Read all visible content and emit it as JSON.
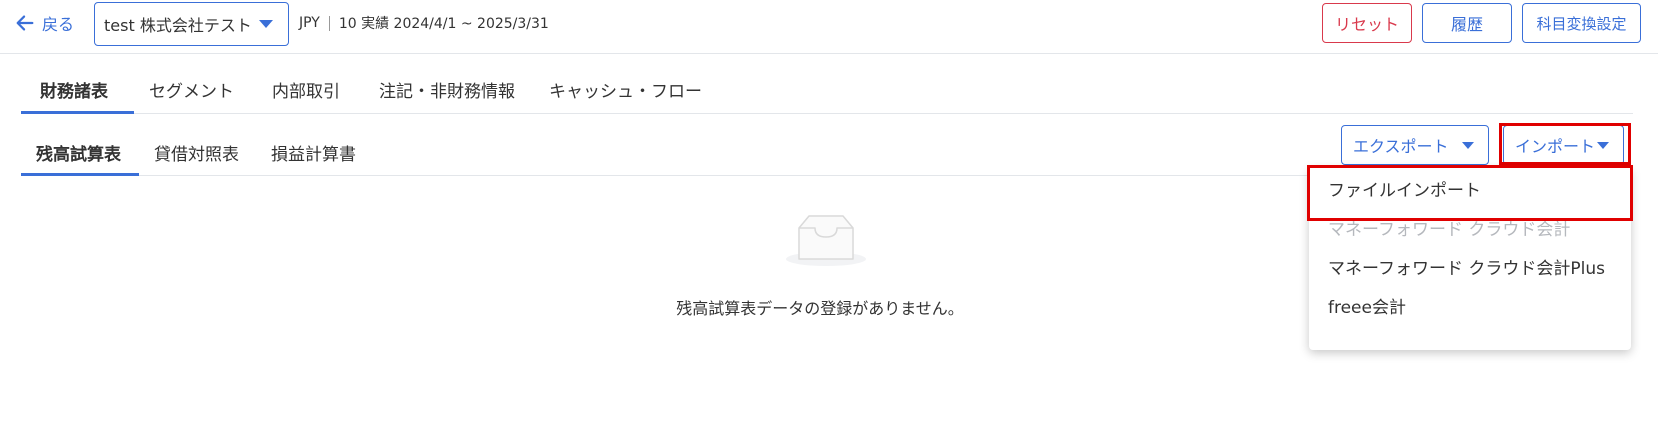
{
  "header": {
    "back_label": "戻る",
    "company_name": "test 株式会社テスト",
    "currency": "JPY",
    "period": "10 実績 2024/4/1 ~ 2025/3/31",
    "reset_label": "リセット",
    "history_label": "履歴",
    "account_conversion_label": "科目変換設定"
  },
  "primary_tabs": [
    {
      "label": "財務諸表",
      "active": true
    },
    {
      "label": "セグメント",
      "active": false
    },
    {
      "label": "内部取引",
      "active": false
    },
    {
      "label": "注記・非財務情報",
      "active": false
    },
    {
      "label": "キャッシュ・フロー",
      "active": false
    }
  ],
  "secondary_tabs": [
    {
      "label": "残高試算表",
      "active": true
    },
    {
      "label": "貸借対照表",
      "active": false
    },
    {
      "label": "損益計算書",
      "active": false
    }
  ],
  "actions": {
    "export_label": "エクスポート",
    "import_label": "インポート"
  },
  "import_menu": {
    "items": [
      {
        "label": "ファイルインポート",
        "disabled": false
      },
      {
        "label": "マネーフォワード クラウド会計",
        "disabled": true
      },
      {
        "label": "マネーフォワード クラウド会計Plus",
        "disabled": false
      },
      {
        "label": "freee会計",
        "disabled": false
      }
    ]
  },
  "empty_state": {
    "message": "残高試算表データの登録がありません。",
    "icon": "inbox-icon"
  },
  "colors": {
    "accent": "#3a6fd8",
    "danger": "#d9394c",
    "highlight": "#e00000",
    "disabled_text": "#b5b8bd"
  }
}
